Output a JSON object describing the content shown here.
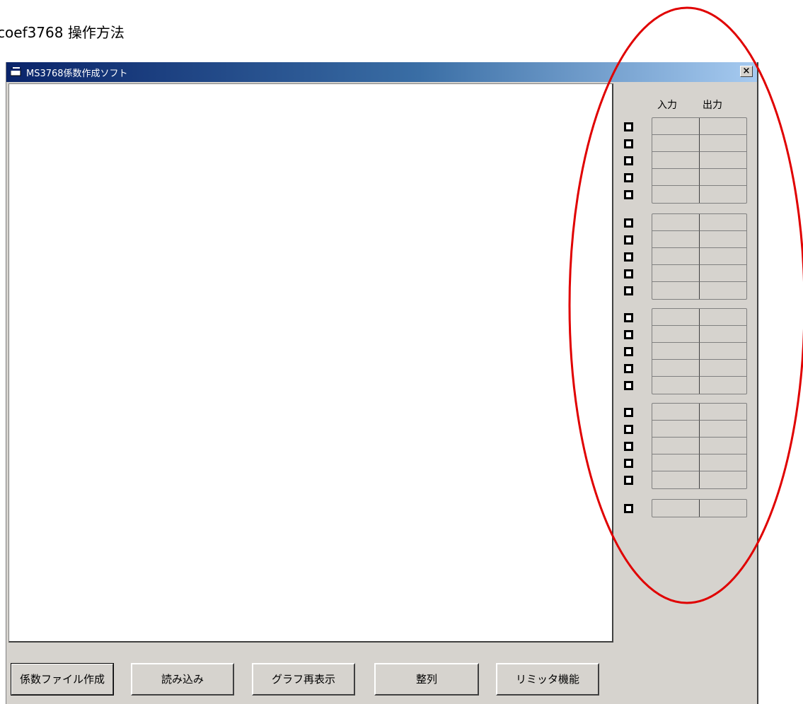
{
  "page": {
    "title": "coef3768  操作方法"
  },
  "window": {
    "title": "MS3768係数作成ソフト",
    "close_label": "×",
    "icon": "app-window-icon"
  },
  "channel_panel": {
    "input_header": "入力",
    "output_header": "出力",
    "groups": [
      {
        "rows": [
          {
            "input": "",
            "output": ""
          },
          {
            "input": "",
            "output": ""
          },
          {
            "input": "",
            "output": ""
          },
          {
            "input": "",
            "output": ""
          },
          {
            "input": "",
            "output": ""
          }
        ]
      },
      {
        "rows": [
          {
            "input": "",
            "output": ""
          },
          {
            "input": "",
            "output": ""
          },
          {
            "input": "",
            "output": ""
          },
          {
            "input": "",
            "output": ""
          },
          {
            "input": "",
            "output": ""
          }
        ]
      },
      {
        "rows": [
          {
            "input": "",
            "output": ""
          },
          {
            "input": "",
            "output": ""
          },
          {
            "input": "",
            "output": ""
          },
          {
            "input": "",
            "output": ""
          },
          {
            "input": "",
            "output": ""
          }
        ]
      },
      {
        "rows": [
          {
            "input": "",
            "output": ""
          },
          {
            "input": "",
            "output": ""
          },
          {
            "input": "",
            "output": ""
          },
          {
            "input": "",
            "output": ""
          },
          {
            "input": "",
            "output": ""
          }
        ]
      },
      {
        "rows": [
          {
            "input": "",
            "output": ""
          }
        ]
      }
    ]
  },
  "buttons": {
    "create_coef_file": "係数ファイル作成",
    "load": "読み込み",
    "redraw_graph": "グラフ再表示",
    "arrange": "整列",
    "limiter": "リミッタ機能"
  },
  "annotation": {
    "color": "#e00000",
    "shape": "ellipse-highlight"
  }
}
